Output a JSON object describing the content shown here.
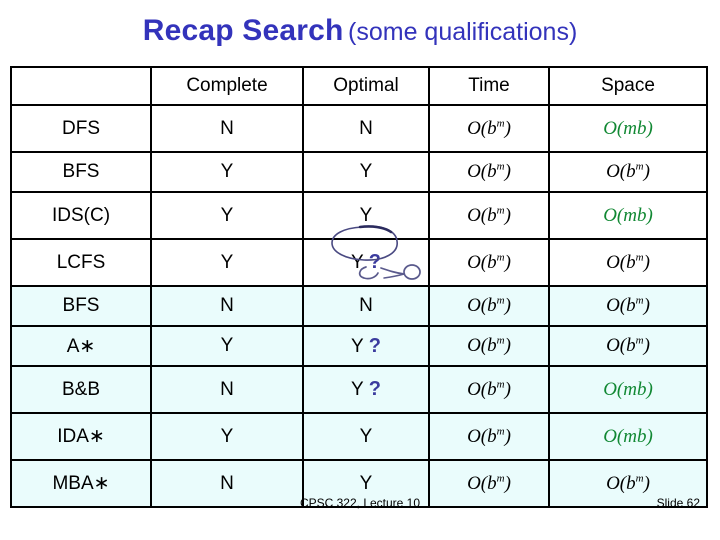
{
  "title": {
    "main": "Recap Search",
    "sub": "(some qualifications)",
    "color": "#3333bb"
  },
  "table": {
    "headers": [
      "",
      "Complete",
      "Optimal",
      "Time",
      "Space"
    ],
    "rows": [
      {
        "label": "DFS",
        "complete": "N",
        "optimal": "N",
        "optimal_q": "",
        "time_base": "O(b",
        "time_exp": "m",
        "time_tail": ")",
        "space_base": "O(mb",
        "space_exp": "",
        "space_tail": ")",
        "space_green": true,
        "shaded": false
      },
      {
        "label": "BFS",
        "complete": "Y",
        "optimal": "Y",
        "optimal_q": "",
        "time_base": "O(b",
        "time_exp": "m",
        "time_tail": ")",
        "space_base": "O(b",
        "space_exp": "m",
        "space_tail": ")",
        "space_green": false,
        "shaded": false
      },
      {
        "label": "IDS(C)",
        "complete": "Y",
        "optimal": "Y",
        "optimal_q": "",
        "time_base": "O(b",
        "time_exp": "m",
        "time_tail": ")",
        "space_base": "O(mb",
        "space_exp": "",
        "space_tail": ")",
        "space_green": true,
        "shaded": false
      },
      {
        "label": "LCFS",
        "complete": "Y",
        "optimal": "Y",
        "optimal_q": "?",
        "time_base": "O(b",
        "time_exp": "m",
        "time_tail": ")",
        "space_base": "O(b",
        "space_exp": "m",
        "space_tail": ")",
        "space_green": false,
        "shaded": false
      },
      {
        "label": "BFS",
        "complete": "N",
        "optimal": "N",
        "optimal_q": "",
        "time_base": "O(b",
        "time_exp": "m",
        "time_tail": ")",
        "space_base": "O(b",
        "space_exp": "m",
        "space_tail": ")",
        "space_green": false,
        "shaded": true
      },
      {
        "label": "A∗",
        "complete": "Y",
        "optimal": "Y",
        "optimal_q": "?",
        "time_base": "O(b",
        "time_exp": "m",
        "time_tail": ")",
        "space_base": "O(b",
        "space_exp": "m",
        "space_tail": ")",
        "space_green": false,
        "shaded": true
      },
      {
        "label": "B&B",
        "complete": "N",
        "optimal": "Y",
        "optimal_q": "?",
        "time_base": "O(b",
        "time_exp": "m",
        "time_tail": ")",
        "space_base": "O(mb",
        "space_exp": "",
        "space_tail": ")",
        "space_green": true,
        "shaded": true
      },
      {
        "label": "IDA∗",
        "complete": "Y",
        "optimal": "Y",
        "optimal_q": "",
        "time_base": "O(b",
        "time_exp": "m",
        "time_tail": ")",
        "space_base": "O(mb",
        "space_exp": "",
        "space_tail": ")",
        "space_green": true,
        "shaded": true
      },
      {
        "label": "MBA∗",
        "complete": "N",
        "optimal": "Y",
        "optimal_q": "",
        "time_base": "O(b",
        "time_exp": "m",
        "time_tail": ")",
        "space_base": "O(b",
        "space_exp": "m",
        "space_tail": ")",
        "space_green": false,
        "shaded": true
      }
    ]
  },
  "annotation": {
    "kind": "handwritten-ink-circle",
    "target": "LCFS optimal cell",
    "ink_color": "#4a4a82"
  },
  "footer": {
    "center": "CPSC 322, Lecture 10",
    "right": "Slide 62"
  },
  "colors": {
    "title": "#3333bb",
    "green_complexity": "#118833",
    "question_mark": "#3b3b9e",
    "shaded_row": "#eafcfc"
  }
}
